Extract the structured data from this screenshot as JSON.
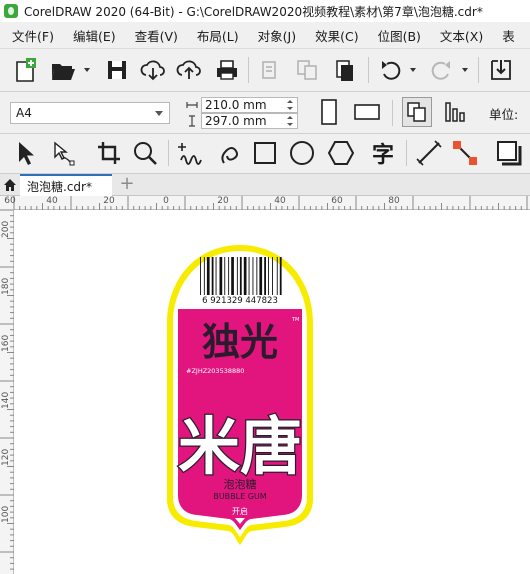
{
  "window": {
    "title": "CorelDRAW 2020 (64-Bit) - G:\\CorelDRAW2020视频教程\\素材\\第7章\\泡泡糖.cdr*"
  },
  "menu": [
    "文件(F)",
    "编辑(E)",
    "查看(V)",
    "布局(L)",
    "对象(J)",
    "效果(C)",
    "位图(B)",
    "文本(X)",
    "表"
  ],
  "property_bar": {
    "page_size": "A4",
    "width": "210.0 mm",
    "height": "297.0 mm",
    "unit_label": "单位:"
  },
  "toolbox": {
    "text_tool_glyph": "字"
  },
  "tabs": {
    "document": "泡泡糖.cdr*",
    "add": "+"
  },
  "ruler": {
    "h_labels": [
      "60",
      "40",
      "20",
      "0",
      "20",
      "40",
      "60",
      "80"
    ],
    "v_labels": [
      "200",
      "180",
      "160",
      "140",
      "120",
      "100"
    ]
  },
  "label": {
    "barcode_number": "6  921329  447823",
    "tm": "TM",
    "brand": "独光",
    "serial": "#ZJHZ203538880",
    "big_text": "米唐",
    "product_name": "泡泡糖",
    "product_name_en": "BUBBLE GUM",
    "open_text": "开启",
    "colors": {
      "outline": "#f7ec00",
      "panel": "#e2157f",
      "brand": "#2a1c2c"
    }
  }
}
